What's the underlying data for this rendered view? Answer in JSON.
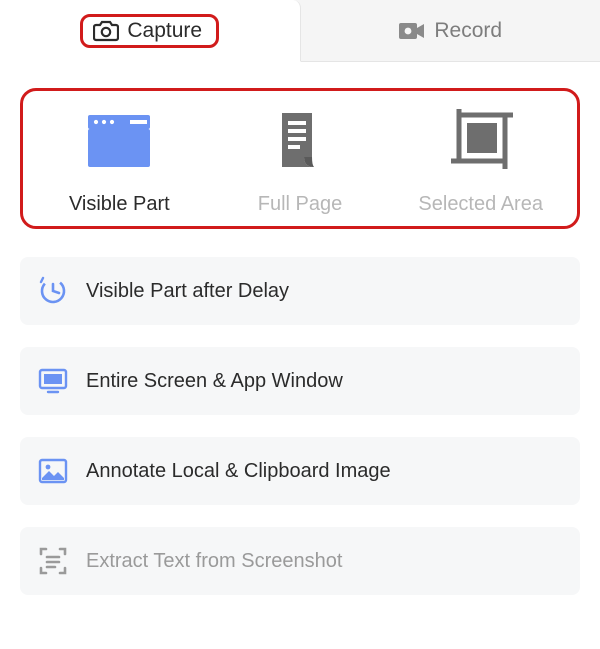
{
  "tabs": {
    "capture": "Capture",
    "record": "Record"
  },
  "modes": {
    "visible_part": "Visible Part",
    "full_page": "Full Page",
    "selected_area": "Selected Area"
  },
  "options": {
    "visible_part_delay": "Visible Part after Delay",
    "entire_screen": "Entire Screen & App Window",
    "annotate_local": "Annotate Local & Clipboard Image",
    "extract_text": "Extract Text from Screenshot"
  },
  "colors": {
    "highlight": "#d11b1b",
    "accent": "#6b93f3",
    "muted": "#6e6e6e"
  },
  "icons": {
    "camera": "camera-icon",
    "video": "video-icon",
    "window": "window-icon",
    "page": "page-icon",
    "crop": "crop-icon",
    "clock": "clock-icon",
    "screen": "screen-icon",
    "annotate": "image-icon",
    "ocr": "scan-text-icon"
  }
}
